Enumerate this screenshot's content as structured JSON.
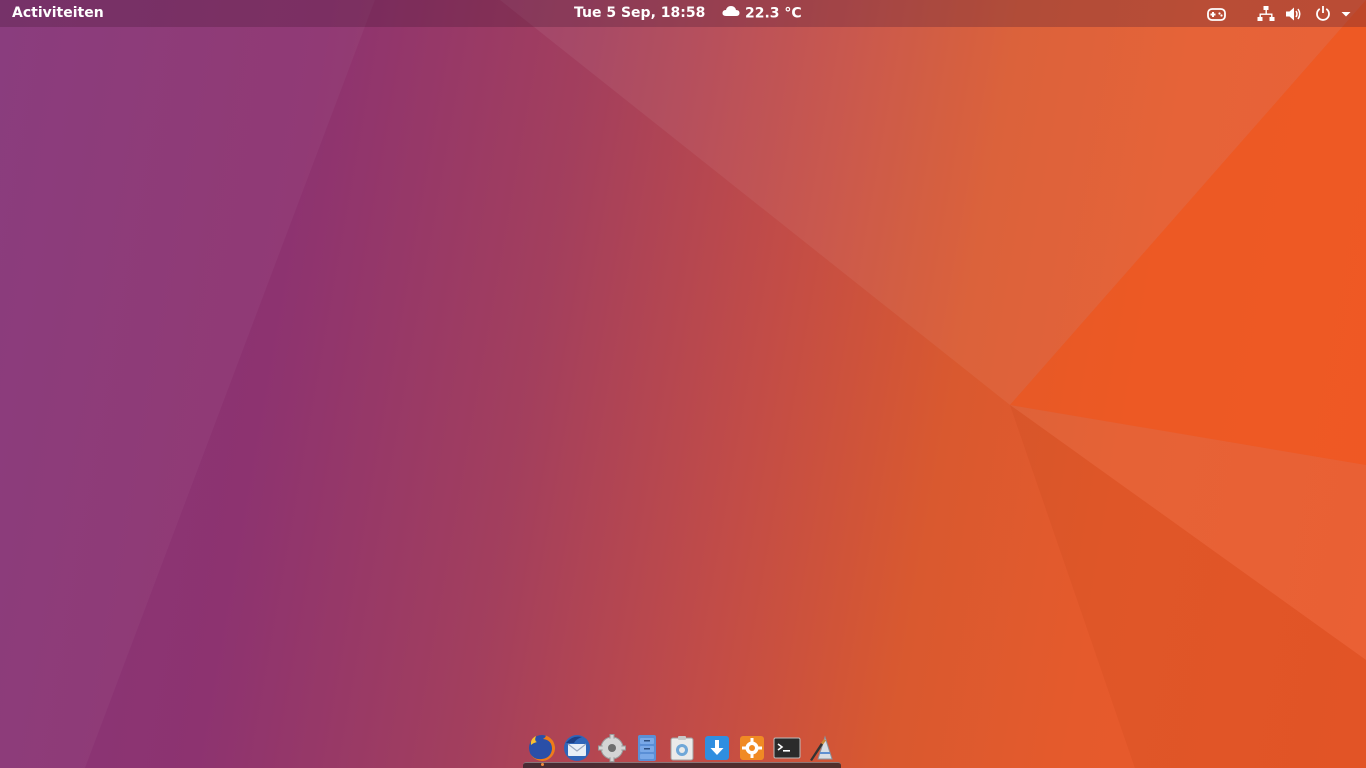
{
  "topbar": {
    "activities_label": "Activiteiten",
    "clock": "Tue  5 Sep, 18:58",
    "weather": {
      "icon": "cloud-icon",
      "temperature": "22.3 °C"
    },
    "tray": [
      {
        "name": "gamepad-indicator-icon"
      },
      {
        "name": "network-icon"
      },
      {
        "name": "volume-icon"
      },
      {
        "name": "power-icon"
      },
      {
        "name": "system-menu-arrow-icon"
      }
    ]
  },
  "dock": {
    "items": [
      {
        "name": "firefox",
        "running": true
      },
      {
        "name": "thunderbird",
        "running": false
      },
      {
        "name": "settings",
        "running": false
      },
      {
        "name": "file-manager",
        "running": false
      },
      {
        "name": "screenshot",
        "running": false
      },
      {
        "name": "downloader",
        "running": false
      },
      {
        "name": "software-updater",
        "running": false
      },
      {
        "name": "terminal",
        "running": false
      },
      {
        "name": "text-editor",
        "running": false
      }
    ]
  },
  "colors": {
    "wallpaper_left": "#86367a",
    "wallpaper_right": "#e9582a",
    "panel_text": "#ffffff"
  }
}
